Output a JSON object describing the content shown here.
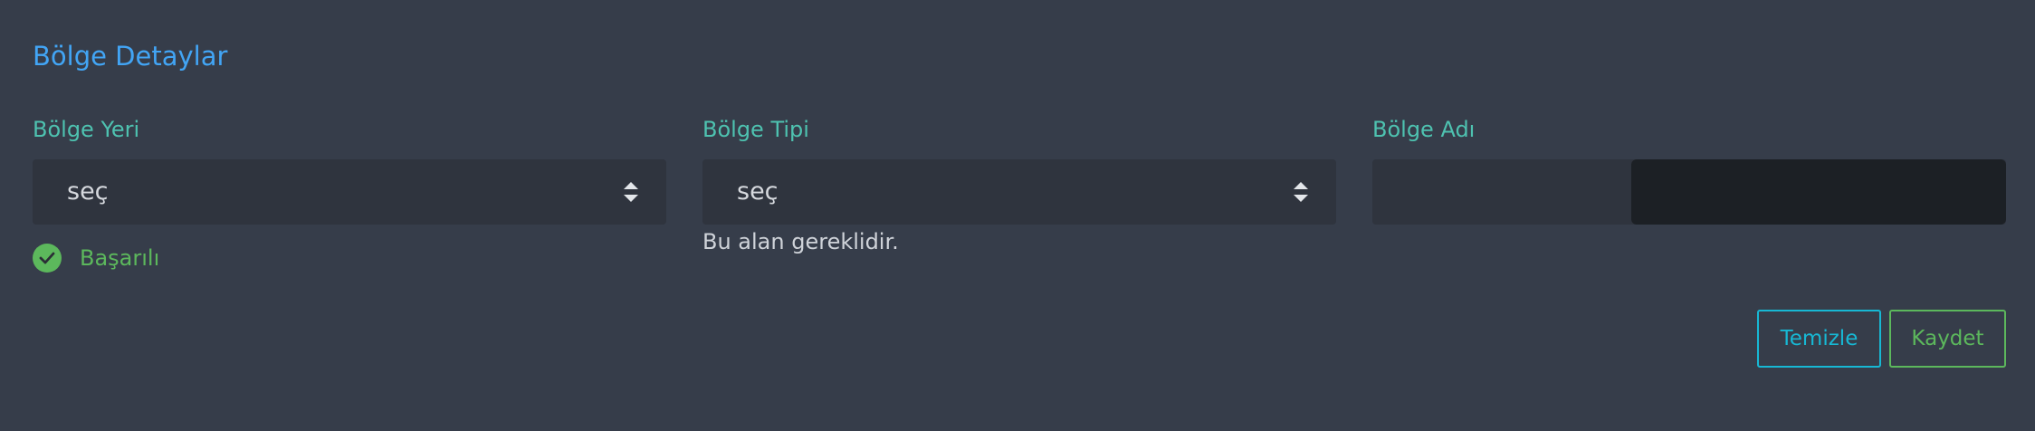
{
  "form": {
    "title": "Bölge Detaylar",
    "fields": [
      {
        "label": "Bölge Yeri",
        "value": "seç",
        "feedback": "Başarılı"
      },
      {
        "label": "Bölge Tipi",
        "value": "seç",
        "help": "Bu alan gereklidir."
      },
      {
        "label": "Bölge Adı",
        "value": ""
      }
    ],
    "buttons": {
      "clear": "Temizle",
      "save": "Kaydet"
    }
  },
  "colors": {
    "background": "#363d4a",
    "title": "#42a5f5",
    "label": "#4ec2b0",
    "success": "#5cb85c",
    "info": "#17b8d4",
    "input_bg": "#2f343e"
  },
  "icons": {
    "select_arrows": "sort-arrows-icon",
    "success": "check-circle-icon"
  }
}
